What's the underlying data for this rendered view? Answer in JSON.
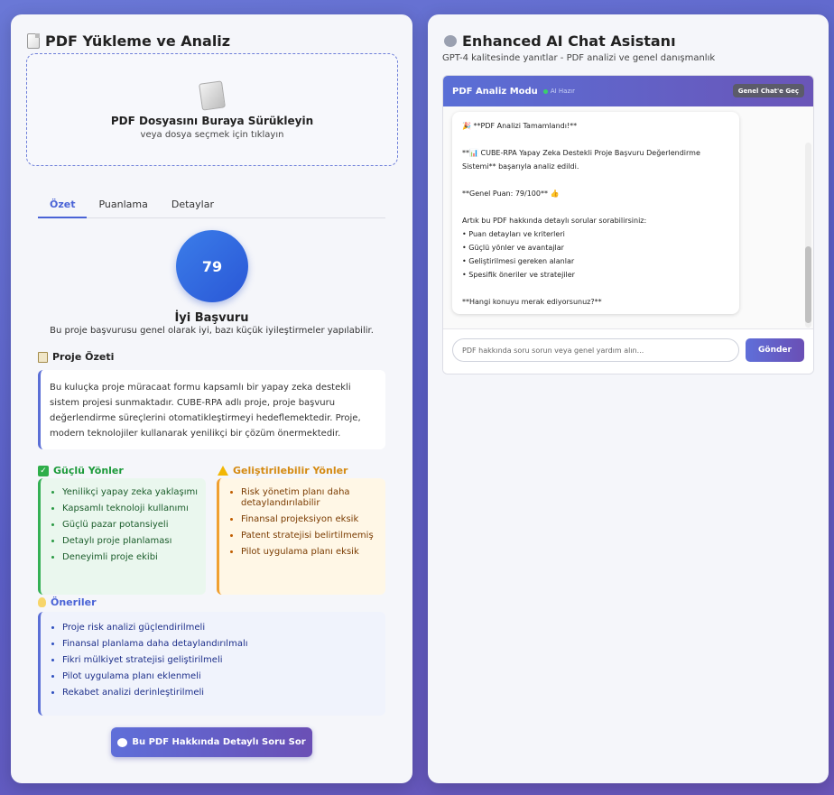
{
  "left": {
    "title": "PDF Yükleme ve Analiz",
    "upload": {
      "title": "PDF Dosyasını Buraya Sürükleyin",
      "subtitle": "veya dosya seçmek için tıklayın"
    },
    "tabs": [
      "Özet",
      "Puanlama",
      "Detaylar"
    ],
    "active_tab": "Özet",
    "score": {
      "value": "79",
      "label": "İyi Başvuru",
      "description": "Bu proje başvurusu genel olarak iyi, bazı küçük iyileştirmeler yapılabilir."
    },
    "summary": {
      "heading": "Proje Özeti",
      "text": "Bu kuluçka proje müracaat formu kapsamlı bir yapay zeka destekli sistem projesi sunmaktadır. CUBE-RPA adlı proje, proje başvuru değerlendirme süreçlerini otomatikleştirmeyi hedeflemektedir. Proje, modern teknolojiler kullanarak yenilikçi bir çözüm önermektedir."
    },
    "strengths": {
      "heading": "Güçlü Yönler",
      "items": [
        "Yenilikçi yapay zeka yaklaşımı",
        "Kapsamlı teknoloji kullanımı",
        "Güçlü pazar potansiyeli",
        "Detaylı proje planlaması",
        "Deneyimli proje ekibi"
      ]
    },
    "improvements": {
      "heading": "Geliştirilebilir Yönler",
      "items": [
        "Risk yönetim planı daha detaylandırılabilir",
        "Finansal projeksiyon eksik",
        "Patent stratejisi belirtilmemiş",
        "Pilot uygulama planı eksik"
      ]
    },
    "recommendations": {
      "heading": "Öneriler",
      "items": [
        "Proje risk analizi güçlendirilmeli",
        "Finansal planlama daha detaylandırılmalı",
        "Fikri mülkiyet stratejisi geliştirilmeli",
        "Pilot uygulama planı eklenmeli",
        "Rekabet analizi derinleştirilmeli"
      ]
    },
    "ask_button": "Bu PDF Hakkında Detaylı Soru Sor"
  },
  "right": {
    "title": "Enhanced AI Chat Asistanı",
    "subtitle": "GPT-4 kalitesinde yanıtlar - PDF analizi ve genel danışmanlık",
    "header": {
      "mode": "PDF Analiz Modu",
      "status": "AI Hazır",
      "switch_button": "Genel Chat'e Geç"
    },
    "message": {
      "lines": [
        "🎉 **PDF Analizi Tamamlandı!**",
        "",
        "**📊 CUBE-RPA Yapay Zeka Destekli Proje Başvuru Değerlendirme",
        "Sistemi** başarıyla analiz edildi.",
        "",
        "**Genel Puan: 79/100** 👍",
        "",
        "Artık bu PDF hakkında detaylı sorular sorabilirsiniz:",
        "• Puan detayları ve kriterleri",
        "• Güçlü yönler ve avantajlar",
        "• Geliştirilmesi gereken alanlar",
        "• Spesifik öneriler ve stratejiler",
        "",
        "**Hangi konuyu merak ediyorsunuz?**"
      ]
    },
    "input_placeholder": "PDF hakkında soru sorun veya genel yardım alın...",
    "send_button": "Gönder"
  },
  "colors": {
    "accent": "#4a63d6",
    "success": "#1c9a3a",
    "warning": "#d48a12"
  }
}
